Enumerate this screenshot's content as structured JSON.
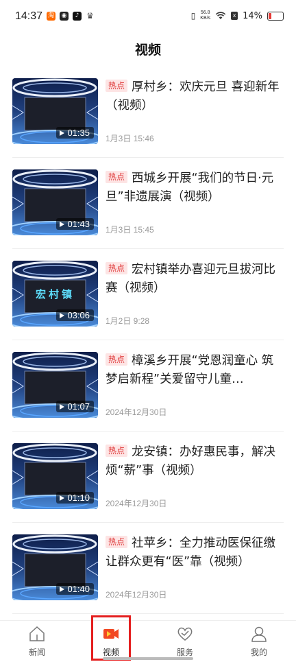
{
  "status_bar": {
    "time": "14:37",
    "speed_value": "56.8",
    "speed_unit": "KB/s",
    "battery": "14%",
    "icons": [
      "taobao-icon",
      "cat-icon",
      "tiktok-icon",
      "crown-icon",
      "vibrate-icon",
      "wifi-icon",
      "sim-icon",
      "battery-icon"
    ]
  },
  "page": {
    "title": "视频"
  },
  "news": [
    {
      "tag": "热点",
      "title": "厚村乡：欢庆元旦 喜迎新年（视频）",
      "date": "1月3日 15:46",
      "duration": "01:35",
      "overlay": ""
    },
    {
      "tag": "热点",
      "title": "西城乡开展“我们的节日·元旦”非遗展演（视频）",
      "date": "1月3日 15:45",
      "duration": "01:43",
      "overlay": ""
    },
    {
      "tag": "热点",
      "title": "宏村镇举办喜迎元旦拔河比赛（视频）",
      "date": "1月2日 9:28",
      "duration": "03:06",
      "overlay": "宏村镇"
    },
    {
      "tag": "热点",
      "title": "樟溪乡开展“党恩润童心 筑梦启新程”关爱留守儿童…",
      "date": "2024年12月30日",
      "duration": "01:07",
      "overlay": ""
    },
    {
      "tag": "热点",
      "title": "龙安镇：办好惠民事，解决烦“薪”事（视频）",
      "date": "2024年12月30日",
      "duration": "01:10",
      "overlay": ""
    },
    {
      "tag": "热点",
      "title": "社苹乡：全力推动医保征缴 让群众更有“医”靠（视频）",
      "date": "2024年12月30日",
      "duration": "01:40",
      "overlay": ""
    }
  ],
  "bottom_nav": [
    {
      "label": "新闻",
      "icon": "home-icon",
      "active": false
    },
    {
      "label": "视频",
      "icon": "video-camera-icon",
      "active": true
    },
    {
      "label": "服务",
      "icon": "heart-icon",
      "active": false
    },
    {
      "label": "我的",
      "icon": "user-icon",
      "active": false
    }
  ],
  "colors": {
    "accent": "#e41e1e",
    "hot_tag_bg": "#fde4e4",
    "hot_tag_text": "#e03c3c"
  }
}
